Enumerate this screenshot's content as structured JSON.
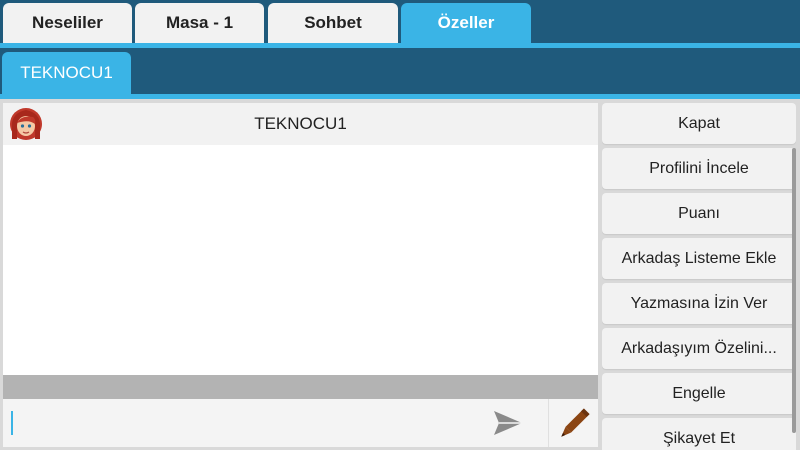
{
  "top_tabs": [
    {
      "label": "Neseliler",
      "active": false
    },
    {
      "label": "Masa - 1",
      "active": false
    },
    {
      "label": "Sohbet",
      "active": false
    },
    {
      "label": "Özeller",
      "active": true
    }
  ],
  "sub_tab": {
    "label": "TEKNOCU1"
  },
  "chat": {
    "header_name": "TEKNOCU1",
    "avatar_icon": "user-avatar-red-hair",
    "input_value": "",
    "send_icon": "send-icon",
    "pencil_icon": "pencil-icon"
  },
  "menu": [
    "Kapat",
    "Profilini İncele",
    "Puanı",
    "Arkadaş Listeme Ekle",
    "Yazmasına İzin Ver",
    "Arkadaşıyım Özelini...",
    "Engelle",
    "Şikayet Et"
  ],
  "colors": {
    "nav_bg": "#1f5a7c",
    "accent": "#3ab4e6",
    "tab_bg": "#f2f2f2",
    "pencil": "#8b4513"
  }
}
